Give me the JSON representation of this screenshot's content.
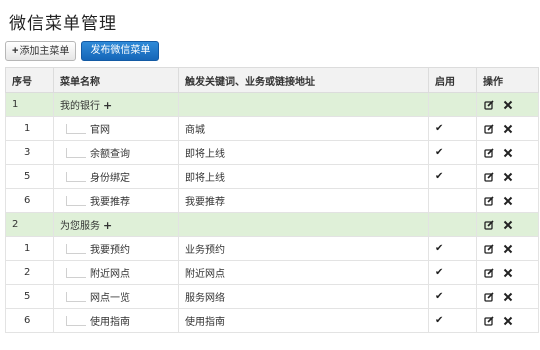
{
  "page": {
    "title": "微信菜单管理"
  },
  "toolbar": {
    "add_main_label": "添加主菜单",
    "publish_label": "发布微信菜单"
  },
  "table": {
    "headers": {
      "index": "序号",
      "name": "菜单名称",
      "keyword": "触发关键词、业务或链接地址",
      "enabled": "启用",
      "actions": "操作"
    },
    "groups": [
      {
        "index": "1",
        "name": "我的银行",
        "items": [
          {
            "index": "1",
            "name": "官网",
            "keyword": "商城",
            "enabled": true
          },
          {
            "index": "3",
            "name": "余额查询",
            "keyword": "即将上线",
            "enabled": true
          },
          {
            "index": "5",
            "name": "身份绑定",
            "keyword": "即将上线",
            "enabled": true
          },
          {
            "index": "6",
            "name": "我要推荐",
            "keyword": "我要推荐",
            "enabled": false
          }
        ]
      },
      {
        "index": "2",
        "name": "为您服务",
        "items": [
          {
            "index": "1",
            "name": "我要预约",
            "keyword": "业务预约",
            "enabled": true
          },
          {
            "index": "2",
            "name": "附近网点",
            "keyword": "附近网点",
            "enabled": true
          },
          {
            "index": "5",
            "name": "网点一览",
            "keyword": "服务网络",
            "enabled": true
          },
          {
            "index": "6",
            "name": "使用指南",
            "keyword": "使用指南",
            "enabled": true
          }
        ]
      }
    ]
  },
  "icons": {
    "add": "plus-icon",
    "enabled": "check-icon",
    "edit": "edit-icon",
    "delete": "delete-icon"
  }
}
